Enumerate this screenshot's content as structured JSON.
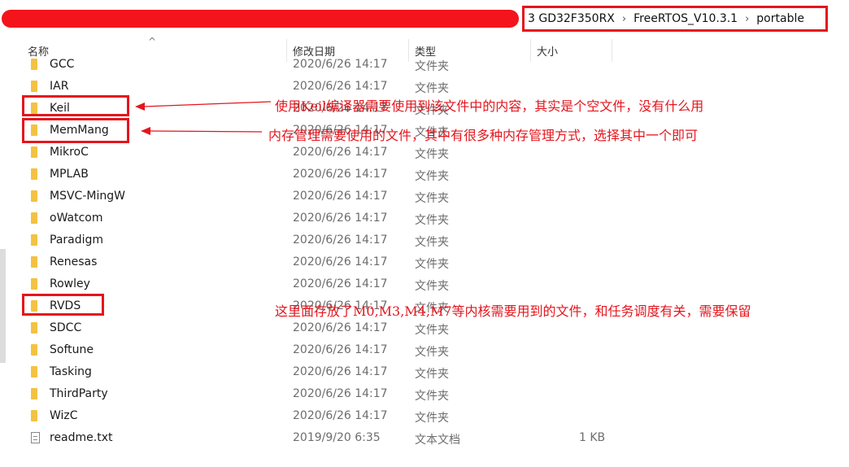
{
  "breadcrumb": [
    "3 GD32F350RX",
    "FreeRTOS_V10.3.1",
    "portable"
  ],
  "columns": {
    "name": "名称",
    "date": "修改日期",
    "type": "类型",
    "size": "大小"
  },
  "files": [
    {
      "name": "GCC",
      "date": "2020/6/26 14:17",
      "type": "文件夹",
      "size": "",
      "icon": "folder-icon"
    },
    {
      "name": "IAR",
      "date": "2020/6/26 14:17",
      "type": "文件夹",
      "size": "",
      "icon": "folder-icon"
    },
    {
      "name": "Keil",
      "date": "2020/6/26 14:17",
      "type": "文件夹",
      "size": "",
      "icon": "folder-icon"
    },
    {
      "name": "MemMang",
      "date": "2020/6/26 14:17",
      "type": "文件夹",
      "size": "",
      "icon": "folder-icon"
    },
    {
      "name": "MikroC",
      "date": "2020/6/26 14:17",
      "type": "文件夹",
      "size": "",
      "icon": "folder-icon"
    },
    {
      "name": "MPLAB",
      "date": "2020/6/26 14:17",
      "type": "文件夹",
      "size": "",
      "icon": "folder-icon"
    },
    {
      "name": "MSVC-MingW",
      "date": "2020/6/26 14:17",
      "type": "文件夹",
      "size": "",
      "icon": "folder-icon"
    },
    {
      "name": "oWatcom",
      "date": "2020/6/26 14:17",
      "type": "文件夹",
      "size": "",
      "icon": "folder-icon"
    },
    {
      "name": "Paradigm",
      "date": "2020/6/26 14:17",
      "type": "文件夹",
      "size": "",
      "icon": "folder-icon"
    },
    {
      "name": "Renesas",
      "date": "2020/6/26 14:17",
      "type": "文件夹",
      "size": "",
      "icon": "folder-icon"
    },
    {
      "name": "Rowley",
      "date": "2020/6/26 14:17",
      "type": "文件夹",
      "size": "",
      "icon": "folder-icon"
    },
    {
      "name": "RVDS",
      "date": "2020/6/26 14:17",
      "type": "文件夹",
      "size": "",
      "icon": "folder-icon"
    },
    {
      "name": "SDCC",
      "date": "2020/6/26 14:17",
      "type": "文件夹",
      "size": "",
      "icon": "folder-icon"
    },
    {
      "name": "Softune",
      "date": "2020/6/26 14:17",
      "type": "文件夹",
      "size": "",
      "icon": "folder-icon"
    },
    {
      "name": "Tasking",
      "date": "2020/6/26 14:17",
      "type": "文件夹",
      "size": "",
      "icon": "folder-icon"
    },
    {
      "name": "ThirdParty",
      "date": "2020/6/26 14:17",
      "type": "文件夹",
      "size": "",
      "icon": "folder-icon"
    },
    {
      "name": "WizC",
      "date": "2020/6/26 14:17",
      "type": "文件夹",
      "size": "",
      "icon": "folder-icon"
    },
    {
      "name": "readme.txt",
      "date": "2019/9/20 6:35",
      "type": "文本文档",
      "size": "1 KB",
      "icon": "text-file-icon"
    }
  ],
  "annotations": {
    "keil": "使用Keil编译器需要使用到该文件中的内容，其实是个空文件，没有什么用",
    "memmang": "内存管理需要使用的文件，其中有很多种内存管理方式，选择其中一个即可",
    "rvds": "这里面存放了M0,M3,M4,M7等内核需要用到的文件，和任务调度有关，需要保留"
  },
  "colors": {
    "annotation": "#e4151d",
    "folder": "#f4c242",
    "redaction": "#f4141b"
  }
}
